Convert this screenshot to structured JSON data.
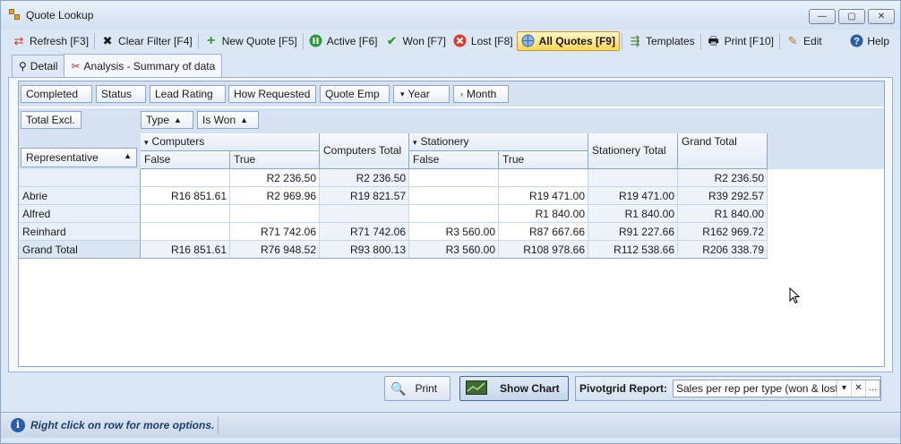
{
  "window": {
    "title": "Quote Lookup",
    "controls": {
      "minimize": "—",
      "maximize": "▢",
      "close": "✕"
    }
  },
  "toolbar": {
    "refresh": "Refresh [F3]",
    "clear_filter": "Clear Filter [F4]",
    "new_quote": "New Quote [F5]",
    "active": "Active [F6]",
    "won": "Won [F7]",
    "lost": "Lost [F8]",
    "all_quotes": "All Quotes [F9]",
    "templates": "Templates",
    "print": "Print [F10]",
    "edit": "Edit",
    "help": "Help"
  },
  "tabs": {
    "detail": "Detail",
    "analysis": "Analysis - Summary of data"
  },
  "pivot": {
    "filter_fields": [
      "Completed",
      "Status",
      "Lead Rating",
      "How Requested",
      "Quote Emp",
      "Year",
      "Month"
    ],
    "data_field": "Total Excl.",
    "column_fields": [
      "Type",
      "Is Won"
    ],
    "row_field": "Representative",
    "column_headers": {
      "computers": "Computers",
      "computers_total": "Computers Total",
      "stationery": "Stationery",
      "stationery_total": "Stationery Total",
      "grand_total": "Grand Total",
      "false": "False",
      "true": "True"
    },
    "rows": [
      {
        "label": "",
        "values": [
          "",
          "R2 236.50",
          "R2 236.50",
          "",
          "",
          "",
          "R2 236.50"
        ]
      },
      {
        "label": "Abrie",
        "values": [
          "R16 851.61",
          "R2 969.96",
          "R19 821.57",
          "",
          "R19 471.00",
          "R19 471.00",
          "R39 292.57"
        ]
      },
      {
        "label": "Alfred",
        "values": [
          "",
          "",
          "",
          "",
          "R1 840.00",
          "R1 840.00",
          "R1 840.00"
        ]
      },
      {
        "label": "Reinhard",
        "values": [
          "",
          "R71 742.06",
          "R71 742.06",
          "R3 560.00",
          "R87 667.66",
          "R91 227.66",
          "R162 969.72"
        ]
      },
      {
        "label": "Grand Total",
        "values": [
          "R16 851.61",
          "R76 948.52",
          "R93 800.13",
          "R3 560.00",
          "R108 978.66",
          "R112 538.66",
          "R206 338.79"
        ]
      }
    ]
  },
  "bottom": {
    "print_label": "Print",
    "show_chart_label": "Show Chart",
    "report_label": "Pivotgrid Report:",
    "report_value": "Sales per rep per type (won & lost)"
  },
  "status": {
    "text": "Right click on row for more options."
  }
}
